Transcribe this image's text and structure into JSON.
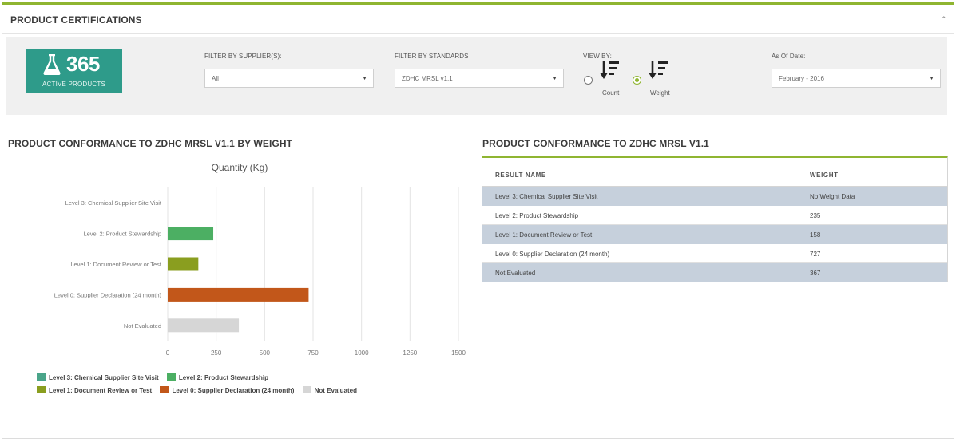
{
  "panel": {
    "title": "PRODUCT CERTIFICATIONS",
    "collapse_icon": "chevron-up-icon"
  },
  "kpi": {
    "icon": "flask-icon",
    "value": "365",
    "label": "ACTIVE PRODUCTS",
    "color": "#2e9b8a"
  },
  "filters": {
    "supplier": {
      "label": "FILTER BY SUPPLIER(S):",
      "value": "All"
    },
    "standards": {
      "label": "FILTER BY STANDARDS",
      "value": "ZDHC MRSL v1.1"
    },
    "view_by": {
      "label": "VIEW BY:",
      "options": [
        {
          "label": "Count",
          "icon": "sort-descending-icon",
          "selected": false
        },
        {
          "label": "Weight",
          "icon": "sort-descending-icon",
          "selected": true
        }
      ]
    },
    "as_of_date": {
      "label": "As Of Date:",
      "value": "February - 2016"
    }
  },
  "chart_section": {
    "title": "PRODUCT CONFORMANCE TO ZDHC MRSL V1.1 BY WEIGHT"
  },
  "chart_data": {
    "type": "bar",
    "orientation": "horizontal",
    "title": "Quantity (Kg)",
    "categories": [
      "Level 3: Chemical Supplier Site Visit",
      "Level 2: Product Stewardship",
      "Level 1: Document Review or Test",
      "Level 0: Supplier Declaration (24 month)",
      "Not Evaluated"
    ],
    "values": [
      0,
      235,
      158,
      727,
      367
    ],
    "colors": [
      "#4aa58a",
      "#4caf63",
      "#8a9e1f",
      "#c2571a",
      "#d6d6d6"
    ],
    "xlim": [
      0,
      1500
    ],
    "xticks": [
      0,
      250,
      500,
      750,
      1000,
      1250,
      1500
    ],
    "xtick_labels": [
      "0",
      "250",
      "500",
      "750",
      "1000",
      "1250",
      "1500"
    ],
    "grid": true,
    "legend_position": "bottom",
    "legend": [
      {
        "label": "Level 3: Chemical Supplier Site Visit",
        "color": "#4aa58a"
      },
      {
        "label": "Level 2: Product Stewardship",
        "color": "#4caf63"
      },
      {
        "label": "Level 1: Document Review or Test",
        "color": "#8a9e1f"
      },
      {
        "label": "Level 0: Supplier Declaration (24 month)",
        "color": "#c2571a"
      },
      {
        "label": "Not Evaluated",
        "color": "#d6d6d6"
      }
    ]
  },
  "table_section": {
    "title": "PRODUCT CONFORMANCE TO ZDHC MRSL V1.1",
    "columns": [
      "RESULT NAME",
      "WEIGHT"
    ],
    "rows": [
      {
        "name": "Level 3: Chemical Supplier Site Visit",
        "weight": "No Weight Data"
      },
      {
        "name": "Level 2: Product Stewardship",
        "weight": "235"
      },
      {
        "name": "Level 1: Document Review or Test",
        "weight": "158"
      },
      {
        "name": "Level 0: Supplier Declaration (24 month)",
        "weight": "727"
      },
      {
        "name": "Not Evaluated",
        "weight": "367"
      }
    ]
  },
  "colors": {
    "accent": "#8fb531",
    "teal": "#2e9b8a",
    "row_alt": "#c6d0dc"
  }
}
